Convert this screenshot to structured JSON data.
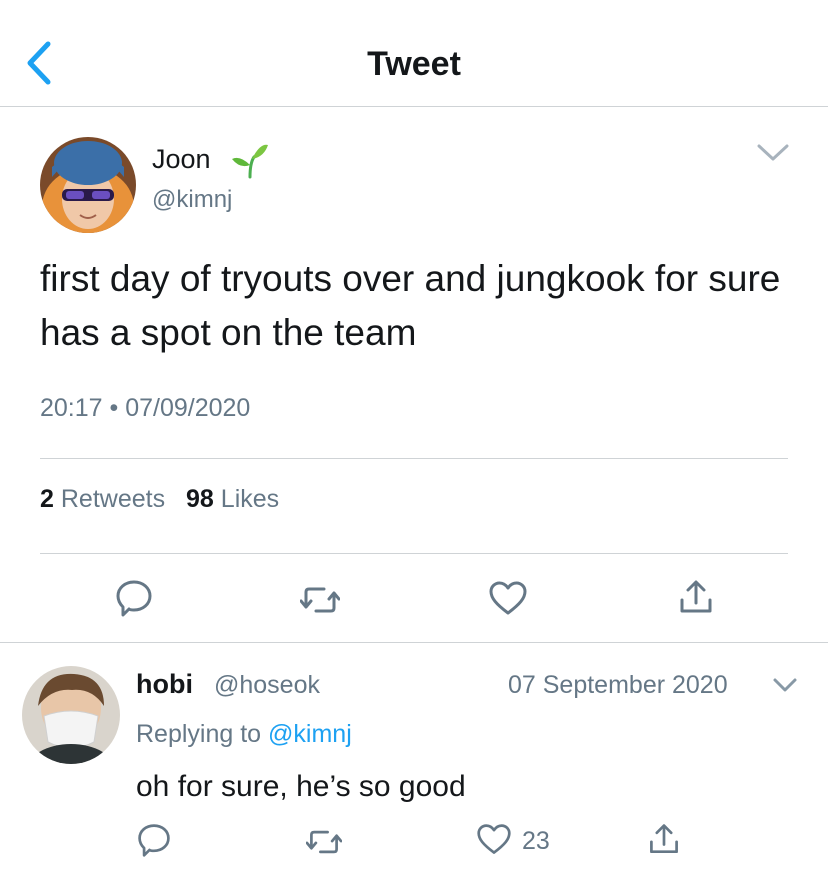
{
  "header": {
    "title": "Tweet",
    "back_icon": "chevron-left-icon",
    "accent": "#1da1f2"
  },
  "tweet": {
    "display_name": "Joon",
    "name_emoji": "seedling-icon",
    "handle": "@kimnj",
    "text": "first day of tryouts over and jungkook for sure has a spot on the team",
    "meta": "20:17 • 07/09/2020",
    "retweet_count": "2",
    "retweet_label": "Retweets",
    "like_count": "98",
    "like_label": "Likes"
  },
  "reply": {
    "display_name": "hobi",
    "handle": "@hoseok",
    "date": "07 September 2020",
    "replying_prefix": "Replying to",
    "replying_to": "@kimnj",
    "text": "oh for sure, he’s so good",
    "like_count": "23"
  },
  "colors": {
    "text": "#14171a",
    "secondary": "#657786",
    "divider": "#cfd3d6",
    "link": "#1da1f2"
  }
}
